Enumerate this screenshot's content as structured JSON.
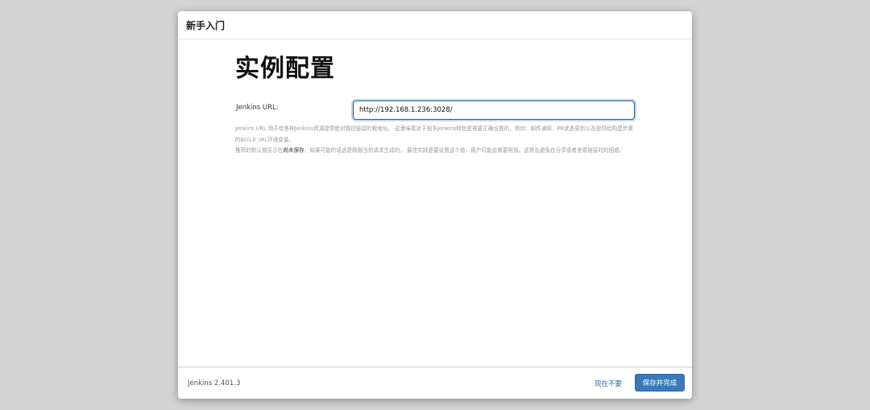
{
  "dialog": {
    "title": "新手入门"
  },
  "page": {
    "title": "实例配置"
  },
  "url_field": {
    "label": "Jenkins URL:",
    "value": "http://192.168.1.236:3028/"
  },
  "help": {
    "line1_pre": "Jenkins URL 用于给各种Jenkins资源提供绝对路径链接的根地址。 这意味着对于很多Jenkins特色是需要正确设置的，例如：邮件通知、PR状态更新以及提供给构建步骤的",
    "code": "BUILD_URL",
    "line1_post": "环境变量。",
    "line2_pre": "推荐的默认值显示在",
    "line2_bold": "尚未保存",
    "line2_post": "，如果可能的话这是根据当前请求生成的。 最佳实践是要设置这个值，用户可能会需要用到。这将会避免在分享或者查看链接时的困惑。"
  },
  "footer": {
    "version": "Jenkins 2.401.3",
    "not_now_label": "现在不要",
    "save_finish_label": "保存并完成"
  },
  "colors": {
    "primary_button": "#3a7ab8",
    "link": "#2a6db0",
    "backdrop": "#d3d3d3"
  }
}
